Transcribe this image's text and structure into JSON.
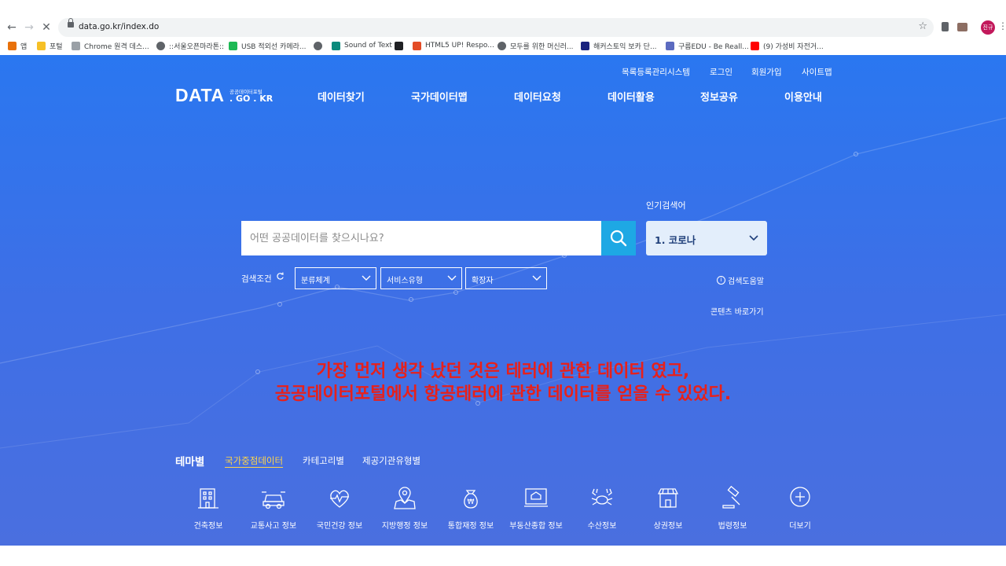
{
  "browser": {
    "url": "data.go.kr/index.do",
    "profile_label": "진규",
    "bookmarks": [
      {
        "label": "앱",
        "color": "#e8710a"
      },
      {
        "label": "포털",
        "color": "#f6c026"
      },
      {
        "label": "Chrome 원격 데스...",
        "color": "#9aa0a6"
      },
      {
        "label": "::서울오픈마라톤::",
        "color": "#5f6368"
      },
      {
        "label": "USB 적외선 카메라...",
        "color": "#1db954"
      },
      {
        "label": "",
        "color": "#5f6368"
      },
      {
        "label": "Sound of Text",
        "color": "#0b8a7c"
      },
      {
        "label": "",
        "color": "#202124"
      },
      {
        "label": "HTML5 UP! Respo...",
        "color": "#e34c26"
      },
      {
        "label": "모두를 위한 머신러...",
        "color": "#5f6368"
      },
      {
        "label": "해커스토익 보카 단...",
        "color": "#1a237e"
      },
      {
        "label": "구름EDU - Be Reall...",
        "color": "#5c6bc0"
      },
      {
        "label": "(9) 가성비 자전거...",
        "color": "#ff0000"
      }
    ]
  },
  "header": {
    "util_links": [
      "목록등록관리시스템",
      "로그인",
      "회원가입",
      "사이트맵"
    ],
    "logo_main": "DATA",
    "logo_sub_top": "공공데이터포털",
    "logo_sub_bottom": ". GO . KR",
    "nav": [
      "데이터찾기",
      "국가데이터맵",
      "데이터요청",
      "데이터활용",
      "정보공유",
      "이용안내"
    ]
  },
  "search": {
    "placeholder": "어떤 공공데이터를 찾으시나요?",
    "popular_label": "인기검색어",
    "popular_value": "1. 코로나",
    "condition_label": "검색조건",
    "filters": [
      "분류체계",
      "서비스유형",
      "확장자"
    ],
    "help_label": "검색도움말",
    "help_icon": "i",
    "shortcut_label": "콘텐츠 바로가기"
  },
  "overlay": {
    "line1": "가장 먼저 생각 났던 것은 테러에 관한 데이터 였고,",
    "line2": "공공데이터포털에서 항공테러에 관한 데이터를 얻을 수 있었다."
  },
  "theme": {
    "title": "테마별",
    "tabs": [
      "국가중점데이터",
      "카테고리별",
      "제공기관유형별"
    ],
    "active_tab": 0,
    "categories": [
      {
        "label": "건축정보",
        "icon": "building-icon"
      },
      {
        "label": "교통사고 정보",
        "icon": "car-icon"
      },
      {
        "label": "국민건강 정보",
        "icon": "heart-icon"
      },
      {
        "label": "지방행정 정보",
        "icon": "map-pin-icon"
      },
      {
        "label": "통합재정 정보",
        "icon": "money-bag-icon"
      },
      {
        "label": "부동산종합 정보",
        "icon": "house-monitor-icon"
      },
      {
        "label": "수산정보",
        "icon": "crab-icon"
      },
      {
        "label": "상권정보",
        "icon": "store-icon"
      },
      {
        "label": "법령정보",
        "icon": "gavel-icon"
      },
      {
        "label": "더보기",
        "icon": "plus-circle-icon"
      }
    ]
  }
}
